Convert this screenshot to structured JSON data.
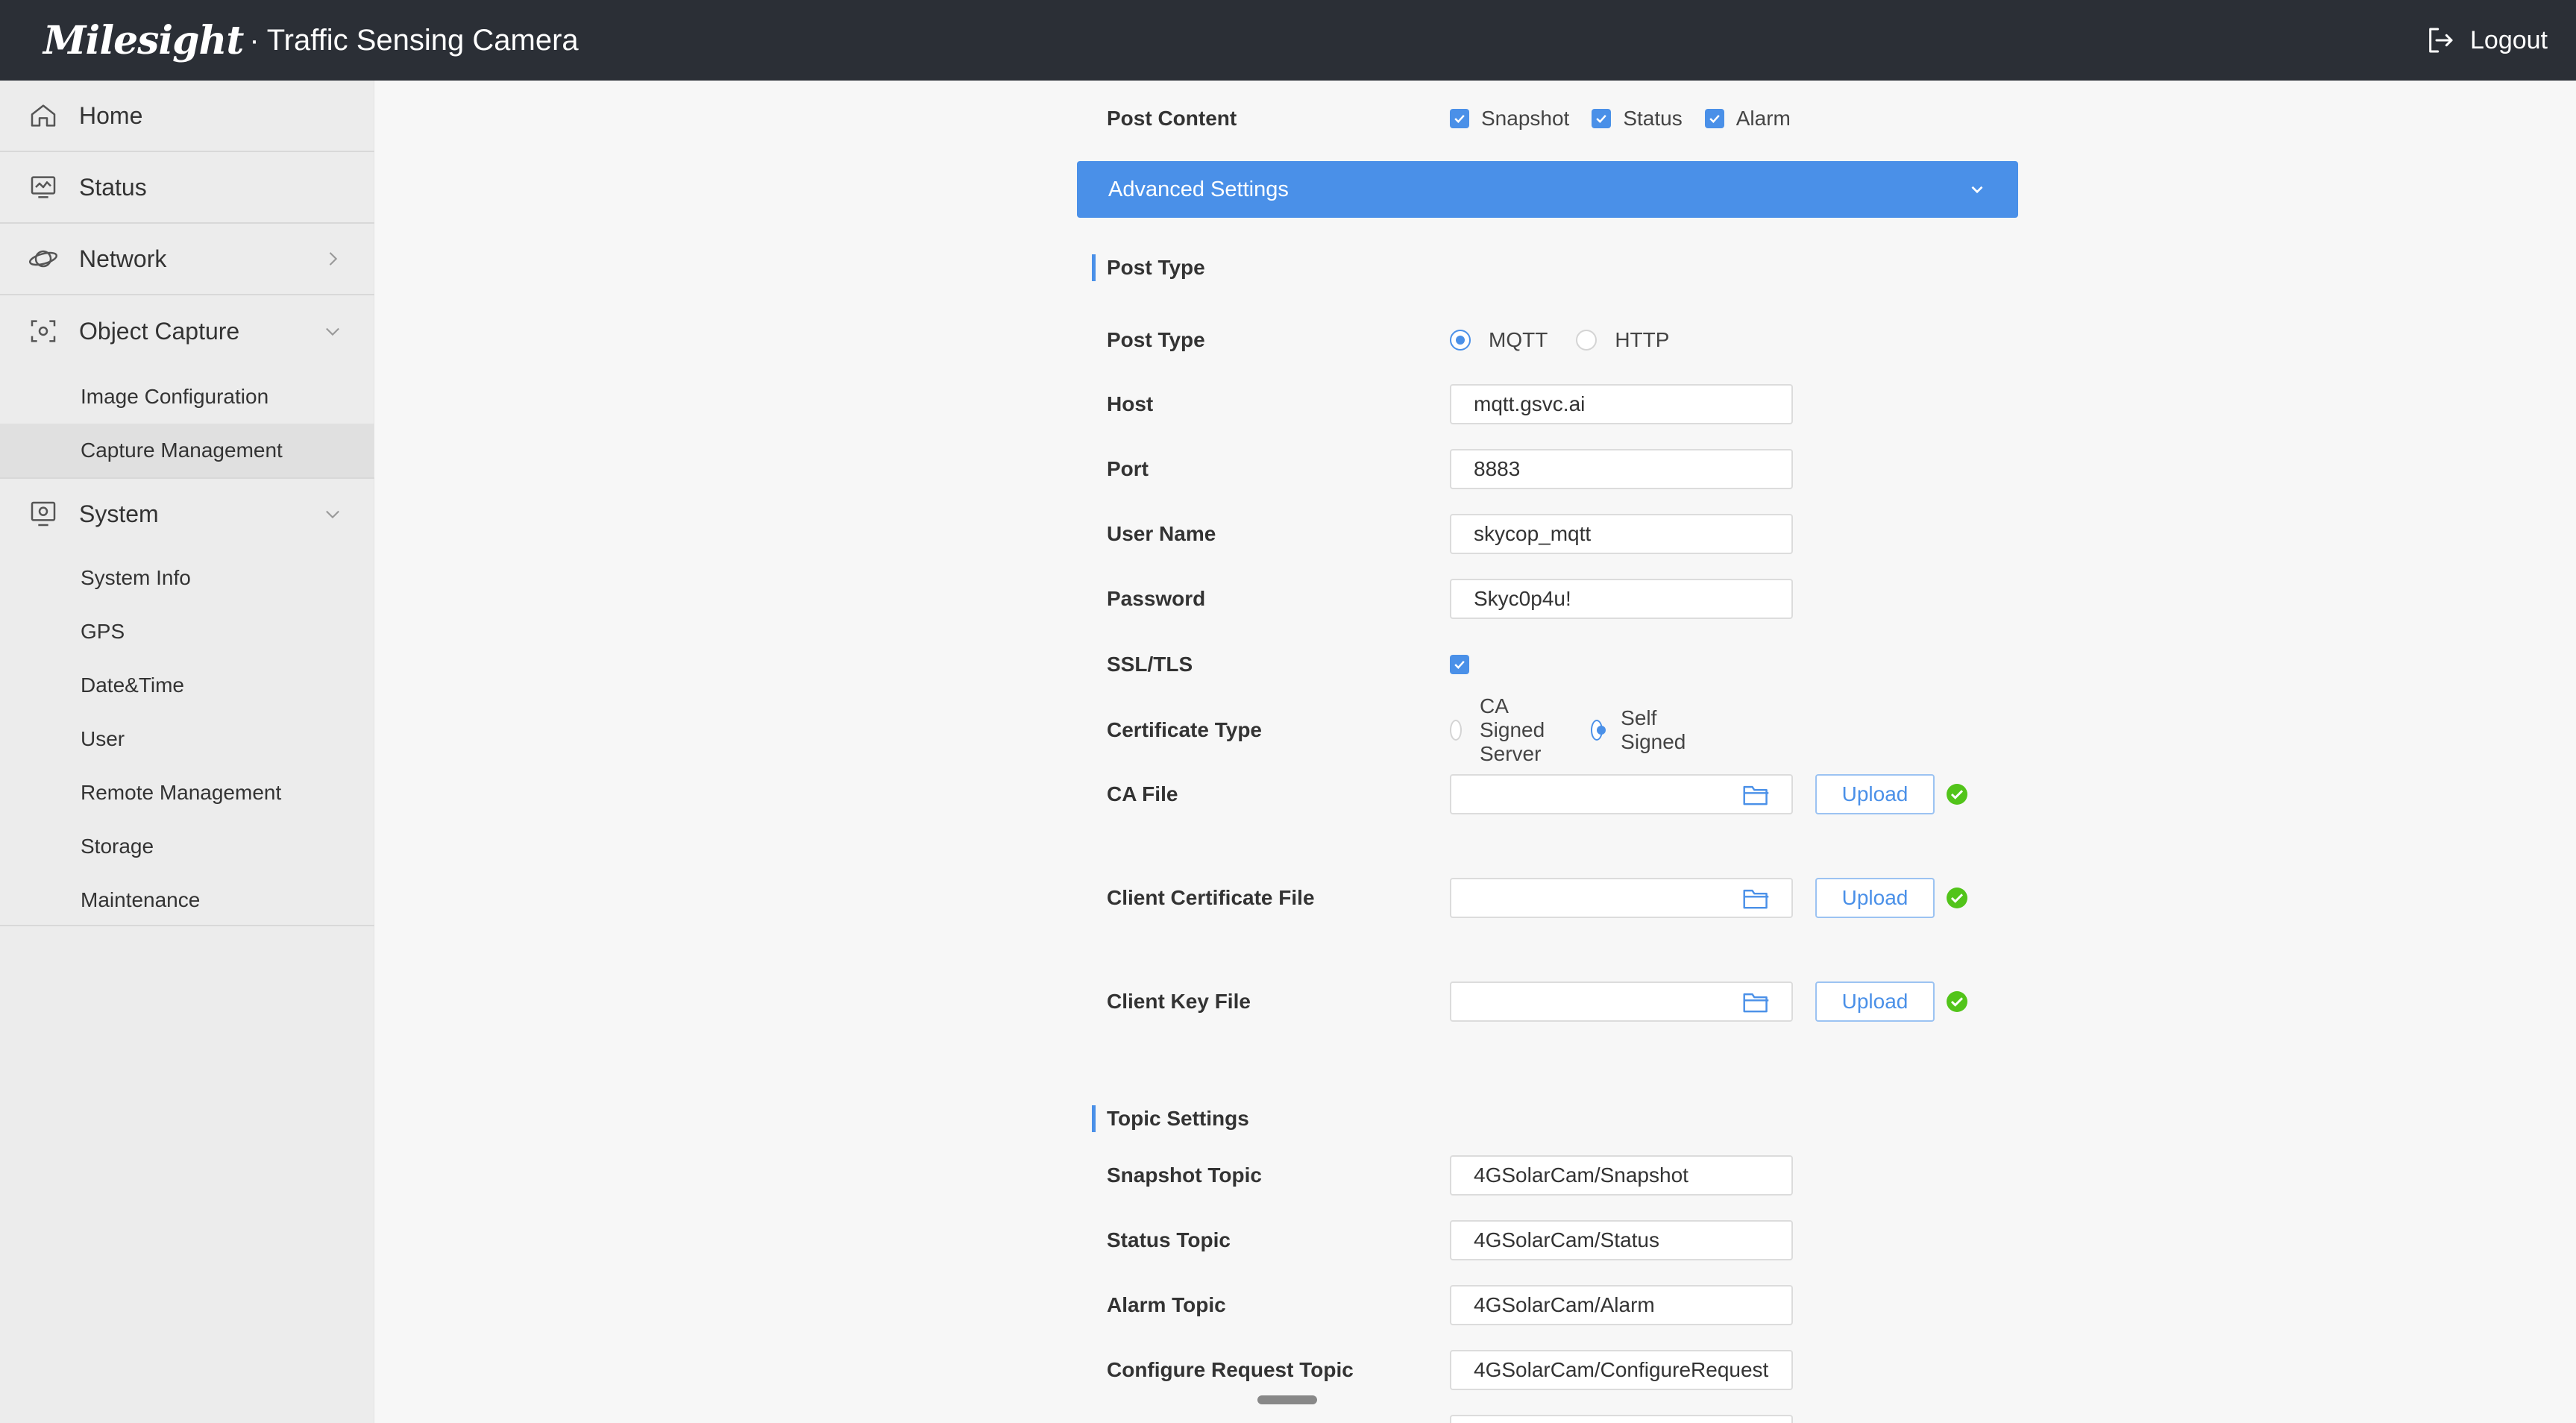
{
  "header": {
    "brand": "Milesight",
    "separator": "·",
    "product": "Traffic Sensing Camera",
    "logout_label": "Logout"
  },
  "sidebar": {
    "items": [
      {
        "label": "Home",
        "icon": "home-icon"
      },
      {
        "label": "Status",
        "icon": "monitor-icon"
      },
      {
        "label": "Network",
        "icon": "globe-icon"
      },
      {
        "label": "Object Capture",
        "icon": "capture-icon"
      },
      {
        "label": "System",
        "icon": "system-icon"
      }
    ],
    "object_capture_sub": [
      "Image Configuration",
      "Capture Management"
    ],
    "system_sub": [
      "System Info",
      "GPS",
      "Date&Time",
      "User",
      "Remote Management",
      "Storage",
      "Maintenance"
    ],
    "active_sub": "Capture Management"
  },
  "form": {
    "post_content": {
      "label": "Post Content",
      "options": [
        {
          "label": "Snapshot",
          "checked": true
        },
        {
          "label": "Status",
          "checked": true
        },
        {
          "label": "Alarm",
          "checked": true
        }
      ]
    },
    "advanced_settings_label": "Advanced Settings",
    "post_type_section": "Post Type",
    "post_type": {
      "label": "Post Type",
      "options": [
        {
          "label": "MQTT",
          "selected": true
        },
        {
          "label": "HTTP",
          "selected": false
        }
      ]
    },
    "host": {
      "label": "Host",
      "value": "mqtt.gsvc.ai"
    },
    "port": {
      "label": "Port",
      "value": "8883"
    },
    "username": {
      "label": "User Name",
      "value": "skycop_mqtt"
    },
    "password": {
      "label": "Password",
      "value": "Skyc0p4u!"
    },
    "ssl_tls": {
      "label": "SSL/TLS",
      "checked": true
    },
    "certificate_type": {
      "label": "Certificate Type",
      "options": [
        {
          "label": "CA Signed Server",
          "selected": false
        },
        {
          "label": "Self Signed",
          "selected": true
        }
      ]
    },
    "ca_file": {
      "label": "CA File",
      "upload_label": "Upload"
    },
    "client_cert_file": {
      "label": "Client Certificate File",
      "upload_label": "Upload"
    },
    "client_key_file": {
      "label": "Client Key File",
      "upload_label": "Upload"
    },
    "topic_section": "Topic Settings",
    "snapshot_topic": {
      "label": "Snapshot Topic",
      "value": "4GSolarCam/Snapshot"
    },
    "status_topic": {
      "label": "Status Topic",
      "value": "4GSolarCam/Status"
    },
    "alarm_topic": {
      "label": "Alarm Topic",
      "value": "4GSolarCam/Alarm"
    },
    "configure_request_topic": {
      "label": "Configure Request Topic",
      "value": "4GSolarCam/ConfigureRequest"
    }
  },
  "colors": {
    "accent": "#4a90e8",
    "header_bg": "#2b2f36",
    "sidebar_bg": "#ececec",
    "success": "#52c41a"
  }
}
